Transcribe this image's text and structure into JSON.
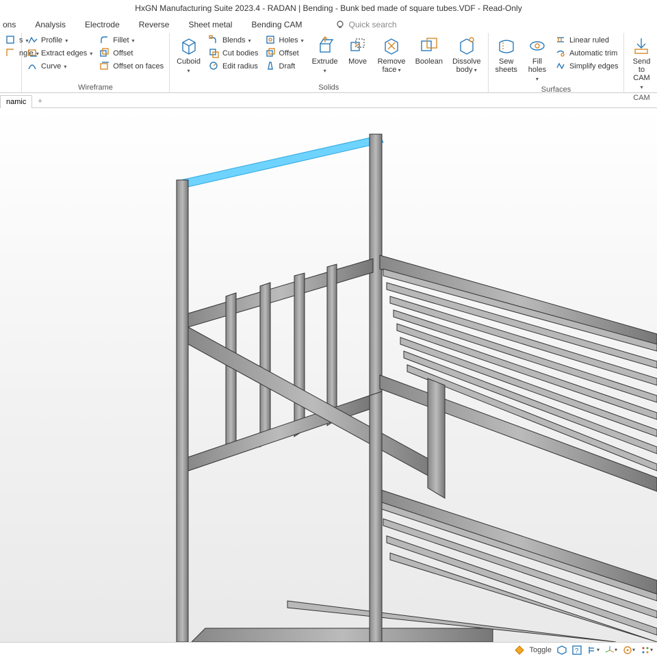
{
  "title": "HxGN Manufacturing Suite 2023.4 - RADAN | Bending - Bunk bed made of square tubes.VDF - Read-Only",
  "menu": {
    "m1": "ons",
    "m2": "Analysis",
    "m3": "Electrode",
    "m4": "Reverse",
    "m5": "Sheet metal",
    "m6": "Bending CAM",
    "search": "Quick search"
  },
  "ribbon": {
    "g1": {
      "b1": "s",
      "b2": "ngle",
      "label": ""
    },
    "wireframe": {
      "profile": "Profile",
      "extract": "Extract edges",
      "curve": "Curve",
      "fillet": "Fillet",
      "offset": "Offset",
      "offsetfaces": "Offset on faces",
      "label": "Wireframe"
    },
    "solids": {
      "cuboid": "Cuboid",
      "blends": "Blends",
      "cutbodies": "Cut bodies",
      "editradius": "Edit radius",
      "holes": "Holes",
      "offset": "Offset",
      "draft": "Draft",
      "extrude": "Extrude",
      "move": "Move",
      "removeface": "Remove\nface",
      "boolean": "Boolean",
      "dissolvebody": "Dissolve\nbody",
      "label": "Solids"
    },
    "surfaces": {
      "sew": "Sew\nsheets",
      "fill": "Fill\nholes",
      "linear": "Linear ruled",
      "autotrim": "Automatic trim",
      "simplify": "Simplify edges",
      "label": "Surfaces"
    },
    "cam": {
      "send": "Send to\nCAM",
      "label": "CAM"
    }
  },
  "tabs": {
    "t1": "namic",
    "plus": "+"
  },
  "status": {
    "toggle": "Toggle"
  }
}
